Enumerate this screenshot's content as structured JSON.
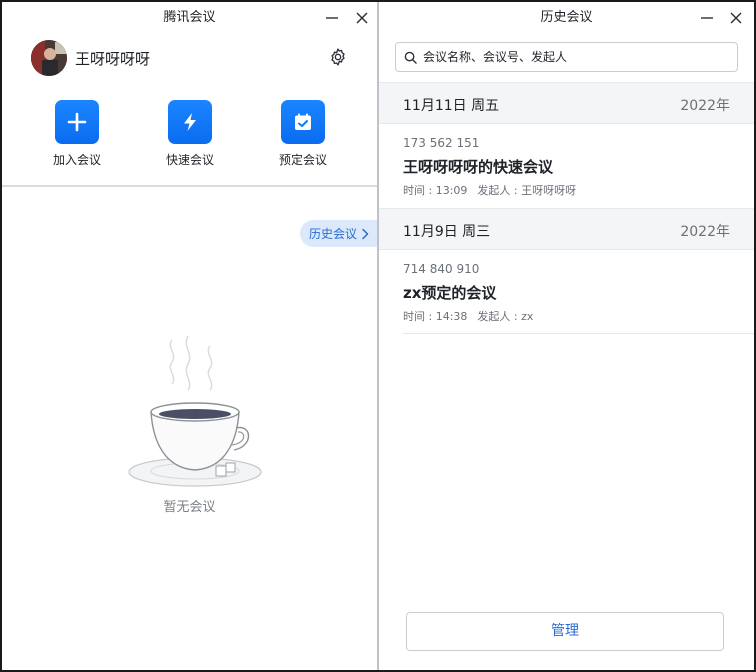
{
  "left_window": {
    "title": "腾讯会议",
    "user": {
      "name": "王呀呀呀呀"
    },
    "actions": [
      {
        "label": "加入会议",
        "icon": "plus-icon"
      },
      {
        "label": "快速会议",
        "icon": "lightning-icon"
      },
      {
        "label": "预定会议",
        "icon": "calendar-check-icon"
      }
    ],
    "history_link": "历史会议",
    "empty_text": "暂无会议"
  },
  "right_window": {
    "title": "历史会议",
    "search": {
      "placeholder": "会议名称、会议号、发起人"
    },
    "groups": [
      {
        "date": "11月11日 周五",
        "year": "2022年",
        "meetings": [
          {
            "id": "173 562 151",
            "title": "王呀呀呀呀的快速会议",
            "time": "时间 : 13:09",
            "host": "发起人 : 王呀呀呀呀"
          }
        ]
      },
      {
        "date": "11月9日 周三",
        "year": "2022年",
        "meetings": [
          {
            "id": "714 840 910",
            "title": "zx预定的会议",
            "time": "时间 : 14:38",
            "host": "发起人 : zx"
          }
        ]
      }
    ],
    "manage_label": "管理"
  },
  "colors": {
    "accent": "#0a6cf0",
    "link": "#2a6ccf",
    "pill_bg": "#dbe9fb",
    "date_bar_bg": "#f4f5f7"
  }
}
